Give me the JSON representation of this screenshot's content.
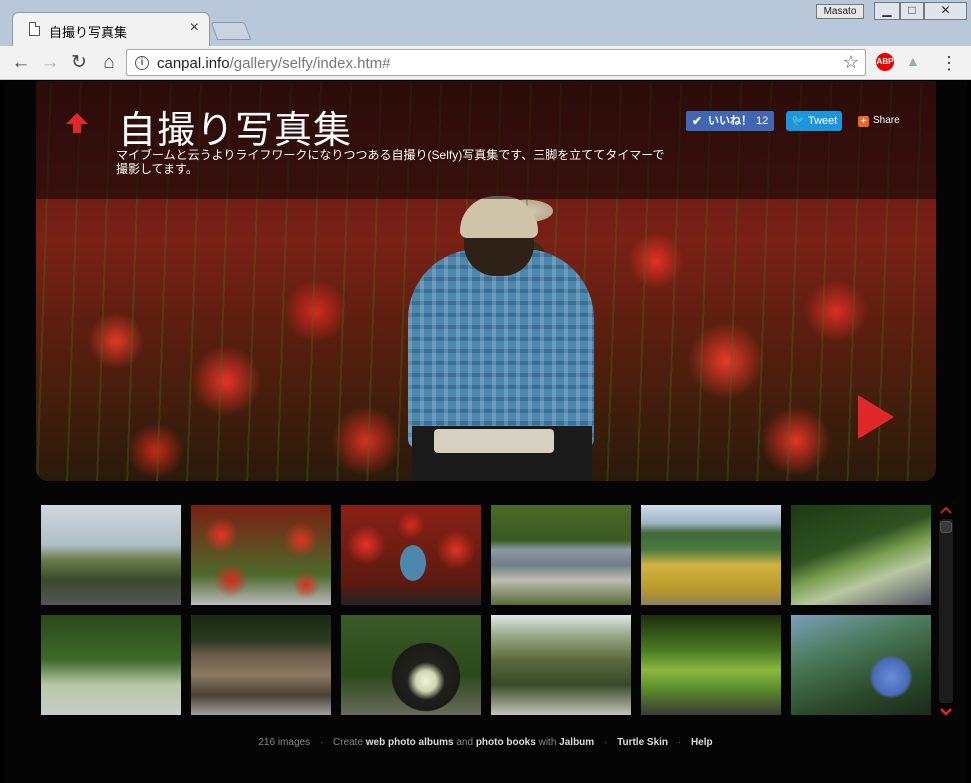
{
  "browser": {
    "tab_title": "自撮り写真集",
    "tab_close": "×",
    "user_badge": "Masato",
    "win_min": "▁",
    "win_max": "□",
    "win_close": "✕",
    "url_host": "canpal.info",
    "url_path": "/gallery/selfy/index.htm#",
    "abp_label": "ABP"
  },
  "gallery": {
    "title": "自撮り写真集",
    "description": "マイブームと云うよりライフワークになりつつある自撮り(Selfy)写真集です、三脚を立ててタイマーで撮影してます。",
    "like_label": "いいね！",
    "like_count": "12",
    "tweet_label": "Tweet",
    "share_label": "Share",
    "share_icon": "+"
  },
  "footer": {
    "count": "216 images",
    "create": "Create",
    "albums": "web photo albums",
    "and": "and",
    "books": "photo books",
    "with": "with",
    "jalbum": "Jalbum",
    "skin": "Turtle Skin",
    "help": "Help"
  },
  "colors": {
    "accent_red": "#e0282a",
    "facebook_blue": "#4267b2",
    "twitter_blue": "#1b95e0"
  }
}
